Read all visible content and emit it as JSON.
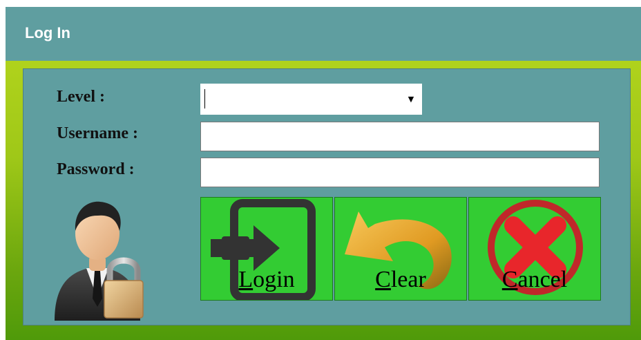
{
  "window": {
    "title": "Log In"
  },
  "form": {
    "level_label": "Level :",
    "username_label": "Username :",
    "password_label": "Password :",
    "level_value": "",
    "username_value": "",
    "password_value": ""
  },
  "buttons": {
    "login": {
      "mnemonic": "L",
      "rest": "ogin",
      "icon": "enter-door-icon"
    },
    "clear": {
      "mnemonic": "C",
      "rest": "lear",
      "icon": "undo-arrow-icon"
    },
    "cancel": {
      "mnemonic": "C",
      "rest": "ancel",
      "icon": "cancel-x-icon"
    }
  },
  "colors": {
    "titlebar": "#5f9ea0",
    "panel": "#5f9ea0",
    "button": "#33cc33",
    "frame_top": "#b9d81e",
    "frame_bottom": "#4f9a0a"
  },
  "icons": {
    "user": "user-lock-icon",
    "dropdown": "chevron-down-icon"
  }
}
